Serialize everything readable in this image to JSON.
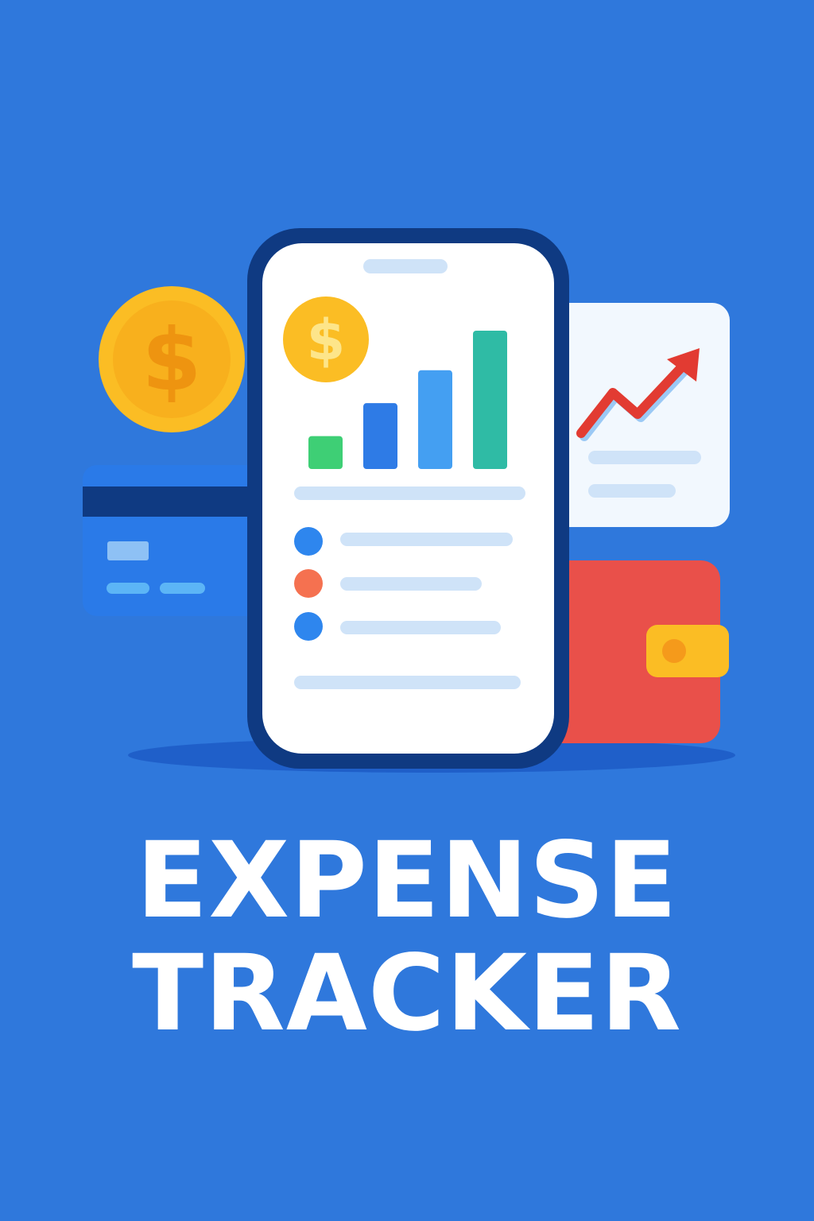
{
  "title": {
    "line1": "EXPENSE",
    "line2": "TRACKER"
  },
  "icons": {
    "coin": "dollar-coin-icon",
    "card": "credit-card-icon",
    "chart": "trend-chart-icon",
    "wallet": "wallet-icon",
    "phone": "phone-icon"
  },
  "colors": {
    "background": "#2f78dc",
    "coin": "#fbbd24",
    "wallet": "#e9504a",
    "trend_arrow": "#e23b32",
    "phone_frame": "#0f3a82",
    "bar_1": "#3ecf75",
    "bar_2": "#2e7be6",
    "bar_3": "#449ff2",
    "bar_4": "#2fbba5"
  },
  "chart_data": {
    "type": "bar",
    "values": [
      1,
      2,
      3,
      4.2
    ]
  }
}
